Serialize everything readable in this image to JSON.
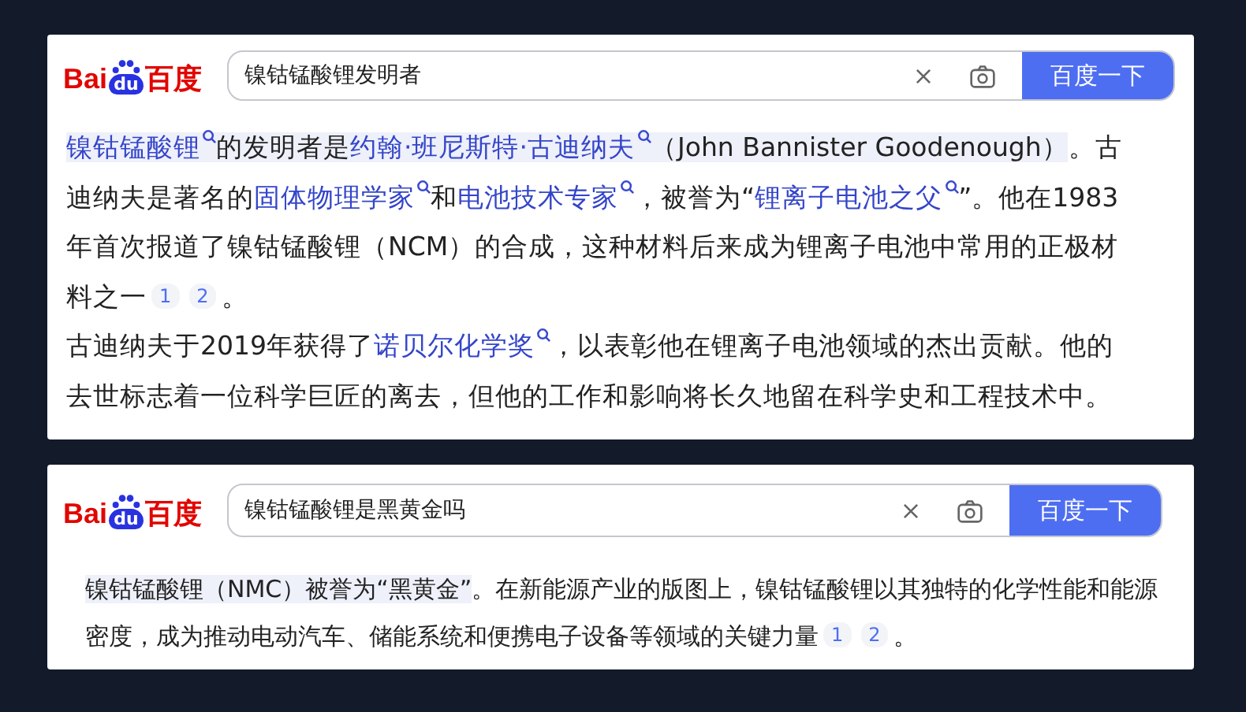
{
  "cards": [
    {
      "logo": {
        "left": "Bai",
        "paw": "du",
        "right": "百度"
      },
      "search": {
        "value": "镍钴锰酸锂发明者",
        "button": "百度一下"
      },
      "paragraphs": [
        [
          {
            "kind": "link",
            "text": "镍钴锰酸锂",
            "highlight": true
          },
          {
            "kind": "text",
            "text": "的发明者是",
            "highlight": true
          },
          {
            "kind": "link",
            "text": "约翰·班尼斯特·古迪纳夫",
            "highlight": true
          },
          {
            "kind": "text",
            "text": "（John Bannister Goodenough）",
            "highlight": true
          },
          {
            "kind": "text",
            "text": "。古迪纳夫是著名的",
            "highlight": false
          },
          {
            "kind": "link",
            "text": "固体物理学家",
            "highlight": false
          },
          {
            "kind": "text",
            "text": "和",
            "highlight": false
          },
          {
            "kind": "link",
            "text": "电池技术专家",
            "highlight": false
          },
          {
            "kind": "text",
            "text": "，被誉为“",
            "highlight": false
          },
          {
            "kind": "link",
            "text": "锂离子电池之父",
            "highlight": false
          },
          {
            "kind": "text",
            "text": "”。他在1983年首次报道了镍钴锰酸锂（NCM）的合成，这种材料后来成为锂离子电池中常用的正极材料之一",
            "highlight": false
          },
          {
            "kind": "ref",
            "text": "1",
            "highlight": false
          },
          {
            "kind": "ref",
            "text": "2",
            "highlight": false
          },
          {
            "kind": "text",
            "text": "。",
            "highlight": false
          }
        ],
        [
          {
            "kind": "text",
            "text": "古迪纳夫于2019年获得了",
            "highlight": false
          },
          {
            "kind": "link",
            "text": "诺贝尔化学奖",
            "highlight": false
          },
          {
            "kind": "text",
            "text": "，以表彰他在锂离子电池领域的杰出贡献。他的去世标志着一位科学巨匠的离去，但他的工作和影响将长久地留在科学史和工程技术中。",
            "highlight": false
          }
        ]
      ]
    },
    {
      "logo": {
        "left": "Bai",
        "paw": "du",
        "right": "百度"
      },
      "search": {
        "value": "镍钴锰酸锂是黑黄金吗",
        "button": "百度一下"
      },
      "paragraphs": [
        [
          {
            "kind": "text",
            "text": "镍钴锰酸锂（NMC）被誉为“黑黄金”",
            "highlight": true
          },
          {
            "kind": "text",
            "text": "。在新能源产业的版图上，镍钴锰酸锂以其独特的化学性能和能源密度，成为推动电动汽车、储能系统和便携电子设备等领域的关键力量",
            "highlight": false
          },
          {
            "kind": "ref",
            "text": "1",
            "highlight": false
          },
          {
            "kind": "ref",
            "text": "2",
            "highlight": false
          },
          {
            "kind": "text",
            "text": "。",
            "highlight": false
          }
        ]
      ]
    }
  ]
}
